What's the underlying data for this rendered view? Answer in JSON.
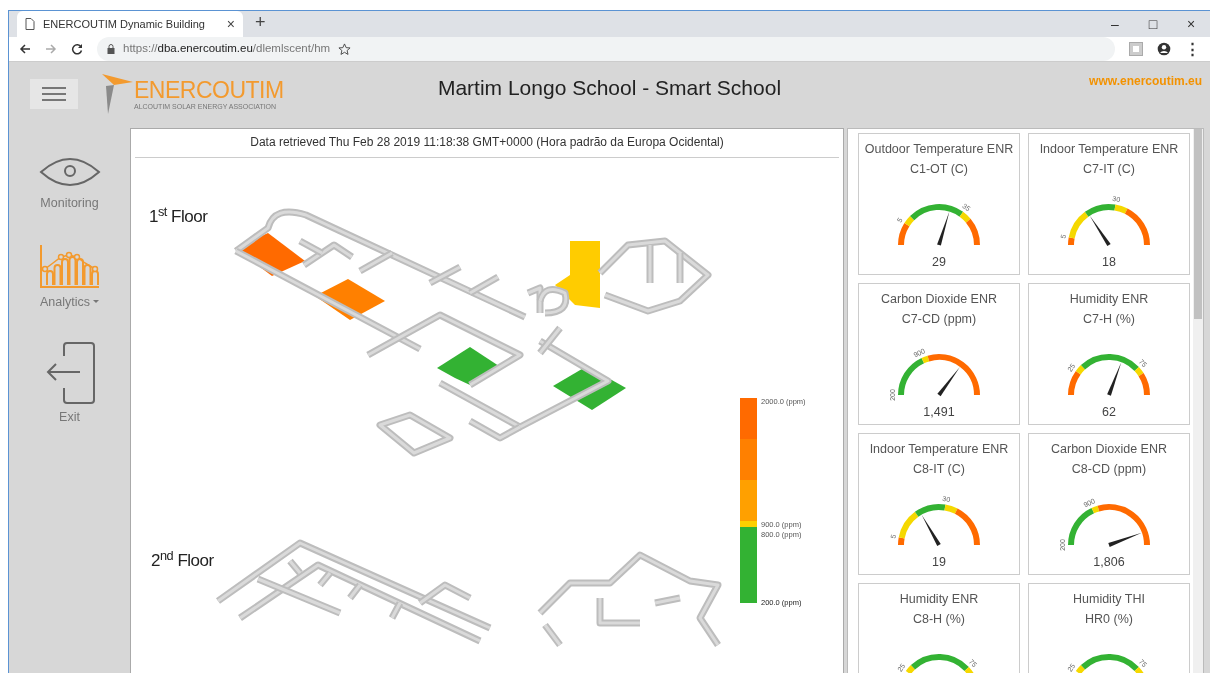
{
  "browser": {
    "tab": {
      "title": "ENERCOUTIM Dynamic Building",
      "close": "×"
    },
    "new_tab": "+",
    "window_controls": [
      "–",
      "□",
      "×"
    ],
    "url": {
      "scheme": "https://",
      "host": "dba.enercoutim.eu",
      "path": "/dlemlscent/hm"
    },
    "menu": "⋮"
  },
  "header": {
    "logo": {
      "name": "ENERCOUTIM",
      "tagline": "ALCOUTIM SOLAR ENERGY ASSOCIATION"
    },
    "title": "Martim Longo School - Smart School",
    "link": "www.enercoutim.eu"
  },
  "sidebar": {
    "items": [
      {
        "kind": "eye",
        "label": "Monitoring",
        "selected": false,
        "dropdown": false
      },
      {
        "kind": "analytics",
        "label": "Analytics",
        "selected": true,
        "dropdown": true
      },
      {
        "kind": "exit",
        "label": "Exit",
        "selected": false,
        "dropdown": false
      }
    ]
  },
  "main": {
    "retrieved": "Data retrieved Thu Feb 28 2019 11:18:38 GMT+0000 (Hora padrão da Europa Ocidental)",
    "floors": [
      {
        "kind": "first",
        "title": "1$^{st}$ Floor",
        "rooms": [
          {
            "color": "#ff6a00"
          },
          {
            "color": "#ff8000"
          },
          {
            "color": "#ffcc00"
          },
          {
            "color": "#33b233"
          },
          {
            "color": "#33b233"
          }
        ]
      },
      {
        "kind": "second",
        "title": "2$^{nd}$ Floor"
      }
    ],
    "legend": {
      "bands": [
        {
          "color": "#ff6a00"
        },
        {
          "color": "#ff8000"
        },
        {
          "color": "#ffa000"
        },
        {
          "color": "#ffd000"
        },
        {
          "color": "#33b233"
        }
      ],
      "labels": [
        "2000.0 (ppm)",
        "900.0 (ppm)",
        "800.0 (ppm)",
        "200.0 (ppm)"
      ]
    }
  },
  "gauges": [
    {
      "kind": "outdoor_temperature",
      "title": "Outdoor Temperature ENR",
      "subtitle": "C1-OT (C)",
      "ticks": [
        "5",
        "35"
      ],
      "value": "29",
      "segments": [
        {
          "color": "#ff6a00"
        },
        {
          "color": "#f5d800"
        },
        {
          "color": "#33b233"
        },
        {
          "color": "#f5d800"
        },
        {
          "color": "#ff6a00"
        }
      ]
    },
    {
      "kind": "indoor_temperature",
      "title": "Indoor Temperature ENR",
      "subtitle": "C7-IT (C)",
      "ticks": [
        "5",
        "30"
      ],
      "value": "18",
      "segments": [
        {
          "color": "#ff6a00"
        },
        {
          "color": "#f5d800"
        },
        {
          "color": "#33b233"
        },
        {
          "color": "#f5d800"
        },
        {
          "color": "#ff6a00"
        }
      ]
    },
    {
      "kind": "carbon_dioxide",
      "title": "Carbon Dioxide ENR",
      "subtitle": "C7-CD (ppm)",
      "ticks": [
        "200",
        "900"
      ],
      "value": "1,491",
      "segments": [
        {
          "color": "#33b233"
        },
        {
          "color": "#f5d800"
        },
        {
          "color": "#ff6a00"
        }
      ]
    },
    {
      "kind": "humidity",
      "title": "Humidity ENR",
      "subtitle": "C7-H (%)",
      "ticks": [
        "25",
        "75"
      ],
      "value": "62",
      "segments": [
        {
          "color": "#ff6a00"
        },
        {
          "color": "#f5d800"
        },
        {
          "color": "#33b233"
        },
        {
          "color": "#f5d800"
        },
        {
          "color": "#ff6a00"
        }
      ]
    },
    {
      "kind": "indoor_temperature",
      "title": "Indoor Temperature ENR",
      "subtitle": "C8-IT (C)",
      "ticks": [
        "5",
        "30"
      ],
      "value": "19",
      "segments": [
        {
          "color": "#ff6a00"
        },
        {
          "color": "#f5d800"
        },
        {
          "color": "#33b233"
        },
        {
          "color": "#f5d800"
        },
        {
          "color": "#ff6a00"
        }
      ]
    },
    {
      "kind": "carbon_dioxide",
      "title": "Carbon Dioxide ENR",
      "subtitle": "C8-CD (ppm)",
      "ticks": [
        "200",
        "900"
      ],
      "value": "1,806",
      "segments": [
        {
          "color": "#33b233"
        },
        {
          "color": "#f5d800"
        },
        {
          "color": "#ff6a00"
        }
      ]
    },
    {
      "kind": "humidity_top",
      "title": "Humidity ENR",
      "subtitle": "C8-H (%)",
      "ticks": [
        "25",
        "75"
      ],
      "segments": [
        {
          "color": "#f5d800"
        },
        {
          "color": "#33b233"
        },
        {
          "color": "#f5d800"
        }
      ]
    },
    {
      "kind": "humidity_top",
      "title": "Humidity THI",
      "subtitle": "HR0 (%)",
      "ticks": [
        "25",
        "75"
      ],
      "segments": [
        {
          "color": "#f5d800"
        },
        {
          "color": "#33b233"
        },
        {
          "color": "#f5d800"
        }
      ]
    }
  ]
}
